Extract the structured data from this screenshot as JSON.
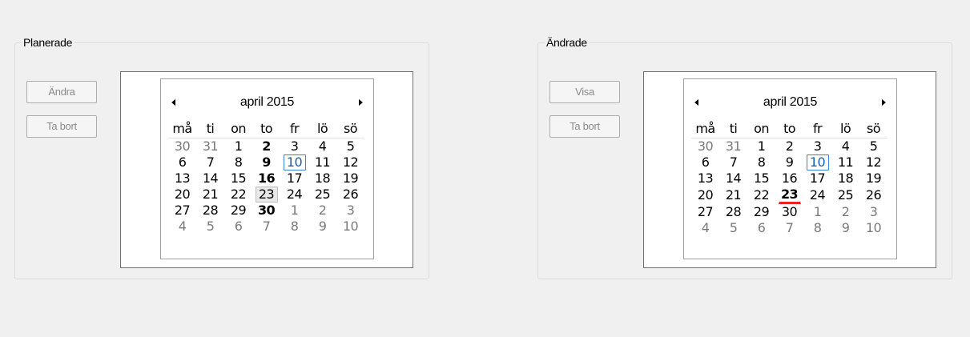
{
  "left_panel": {
    "title": "Planerade",
    "buttons": [
      "Ändra",
      "Ta bort"
    ],
    "calendar": {
      "month_label": "april 2015",
      "weekdays": [
        "må",
        "ti",
        "on",
        "to",
        "fr",
        "lö",
        "sö"
      ],
      "weeks": [
        [
          {
            "d": "30",
            "o": true
          },
          {
            "d": "31",
            "o": true
          },
          {
            "d": "1"
          },
          {
            "d": "2",
            "b": true
          },
          {
            "d": "3"
          },
          {
            "d": "4"
          },
          {
            "d": "5"
          }
        ],
        [
          {
            "d": "6"
          },
          {
            "d": "7"
          },
          {
            "d": "8"
          },
          {
            "d": "9",
            "b": true
          },
          {
            "d": "10",
            "today": true
          },
          {
            "d": "11"
          },
          {
            "d": "12"
          }
        ],
        [
          {
            "d": "13"
          },
          {
            "d": "14"
          },
          {
            "d": "15"
          },
          {
            "d": "16",
            "b": true
          },
          {
            "d": "17"
          },
          {
            "d": "18"
          },
          {
            "d": "19"
          }
        ],
        [
          {
            "d": "20"
          },
          {
            "d": "21"
          },
          {
            "d": "22"
          },
          {
            "d": "23",
            "hover": true
          },
          {
            "d": "24"
          },
          {
            "d": "25"
          },
          {
            "d": "26"
          }
        ],
        [
          {
            "d": "27"
          },
          {
            "d": "28"
          },
          {
            "d": "29"
          },
          {
            "d": "30",
            "b": true
          },
          {
            "d": "1",
            "o": true
          },
          {
            "d": "2",
            "o": true
          },
          {
            "d": "3",
            "o": true
          }
        ],
        [
          {
            "d": "4",
            "o": true
          },
          {
            "d": "5",
            "o": true
          },
          {
            "d": "6",
            "o": true
          },
          {
            "d": "7",
            "o": true
          },
          {
            "d": "8",
            "o": true
          },
          {
            "d": "9",
            "o": true
          },
          {
            "d": "10",
            "o": true
          }
        ]
      ]
    }
  },
  "right_panel": {
    "title": "Ändrade",
    "buttons": [
      "Visa",
      "Ta bort"
    ],
    "calendar": {
      "month_label": "april 2015",
      "weekdays": [
        "må",
        "ti",
        "on",
        "to",
        "fr",
        "lö",
        "sö"
      ],
      "weeks": [
        [
          {
            "d": "30",
            "o": true
          },
          {
            "d": "31",
            "o": true
          },
          {
            "d": "1"
          },
          {
            "d": "2"
          },
          {
            "d": "3"
          },
          {
            "d": "4"
          },
          {
            "d": "5"
          }
        ],
        [
          {
            "d": "6"
          },
          {
            "d": "7"
          },
          {
            "d": "8"
          },
          {
            "d": "9"
          },
          {
            "d": "10",
            "today": true
          },
          {
            "d": "11"
          },
          {
            "d": "12"
          }
        ],
        [
          {
            "d": "13"
          },
          {
            "d": "14"
          },
          {
            "d": "15"
          },
          {
            "d": "16"
          },
          {
            "d": "17"
          },
          {
            "d": "18"
          },
          {
            "d": "19"
          }
        ],
        [
          {
            "d": "20"
          },
          {
            "d": "21"
          },
          {
            "d": "22"
          },
          {
            "d": "23",
            "b": true,
            "underline": true
          },
          {
            "d": "24"
          },
          {
            "d": "25"
          },
          {
            "d": "26"
          }
        ],
        [
          {
            "d": "27"
          },
          {
            "d": "28"
          },
          {
            "d": "29"
          },
          {
            "d": "30"
          },
          {
            "d": "1",
            "o": true
          },
          {
            "d": "2",
            "o": true
          },
          {
            "d": "3",
            "o": true
          }
        ],
        [
          {
            "d": "4",
            "o": true
          },
          {
            "d": "5",
            "o": true
          },
          {
            "d": "6",
            "o": true
          },
          {
            "d": "7",
            "o": true
          },
          {
            "d": "8",
            "o": true
          },
          {
            "d": "9",
            "o": true
          },
          {
            "d": "10",
            "o": true
          }
        ]
      ]
    }
  },
  "colors": {
    "today_border": "#3b83d6",
    "underline": "#ee2222",
    "disabled_text": "#8a8a8a"
  }
}
